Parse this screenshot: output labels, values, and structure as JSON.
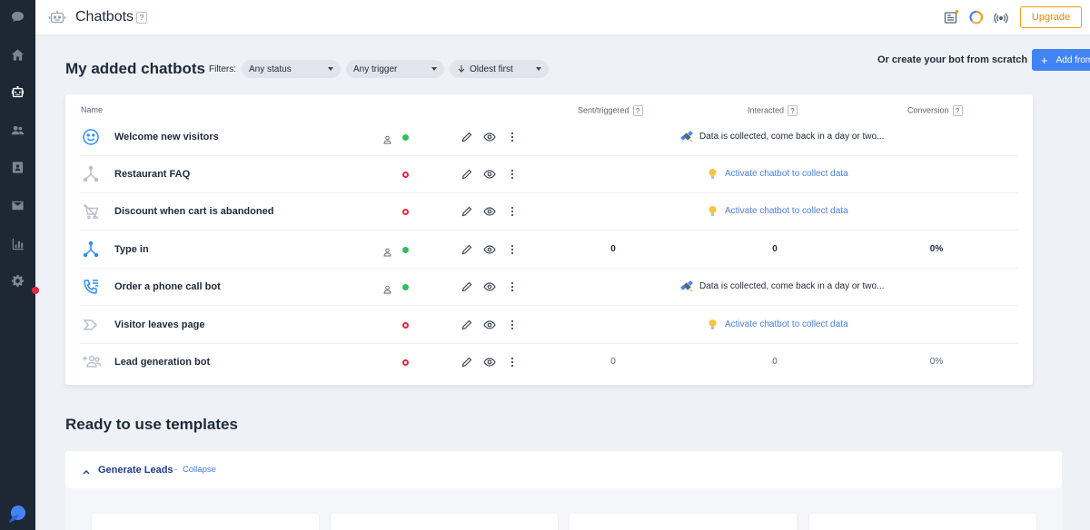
{
  "topbar": {
    "title": "Chatbots",
    "help": "?",
    "upgrade_label": "Upgrade"
  },
  "sidebar": {
    "items": [
      {
        "icon": "chat-bubble-icon"
      },
      {
        "icon": "home-icon"
      },
      {
        "icon": "chatbot-icon",
        "active": true
      },
      {
        "icon": "contacts-icon"
      },
      {
        "icon": "address-book-icon"
      },
      {
        "icon": "mail-icon"
      },
      {
        "icon": "analytics-icon"
      },
      {
        "icon": "settings-icon"
      }
    ]
  },
  "main": {
    "title": "My added chatbots",
    "filters_label": "Filters:",
    "filters": {
      "status": "Any status",
      "trigger": "Any trigger",
      "sort": "Oldest first"
    },
    "scratch_label": "Or create your bot from scratch",
    "add_label": "Add from"
  },
  "table": {
    "headers": {
      "name": "Name",
      "sent": "Sent/triggered",
      "interacted": "Interacted",
      "conversion": "Conversion",
      "help": "?"
    },
    "rows": [
      {
        "name": "Welcome new visitors",
        "icon": "smiley-icon",
        "assigned": true,
        "active": true,
        "message": "Data is collected, come back in a day or two..."
      },
      {
        "name": "Restaurant FAQ",
        "icon": "branch-icon",
        "assigned": false,
        "active": false,
        "activate": "Activate chatbot to collect data"
      },
      {
        "name": "Discount when cart is abandoned",
        "icon": "cart-off-icon",
        "assigned": false,
        "active": false,
        "activate": "Activate chatbot to collect data"
      },
      {
        "name": "Type in",
        "icon": "branch-icon",
        "assigned": true,
        "active": true,
        "sent": "0",
        "interacted": "0",
        "conversion": "0%"
      },
      {
        "name": "Order a phone call bot",
        "icon": "phone-list-icon",
        "assigned": true,
        "active": true,
        "message": "Data is collected, come back in a day or two..."
      },
      {
        "name": "Visitor leaves page",
        "icon": "exit-arrow-icon",
        "assigned": false,
        "active": false,
        "activate": "Activate chatbot to collect data"
      },
      {
        "name": "Lead generation bot",
        "icon": "add-users-icon",
        "assigned": false,
        "active": false,
        "sent": "0",
        "interacted": "0",
        "conversion": "0%"
      }
    ]
  },
  "templates": {
    "title": "Ready to use templates",
    "group_title": "Generate Leads",
    "separator": "-",
    "collapse_label": "Collapse"
  },
  "colors": {
    "accent": "#4384f5",
    "upgrade": "#f39c12",
    "active": "#2ebf5b",
    "inactive": "#e8253d",
    "sidebar": "#1e2734"
  }
}
